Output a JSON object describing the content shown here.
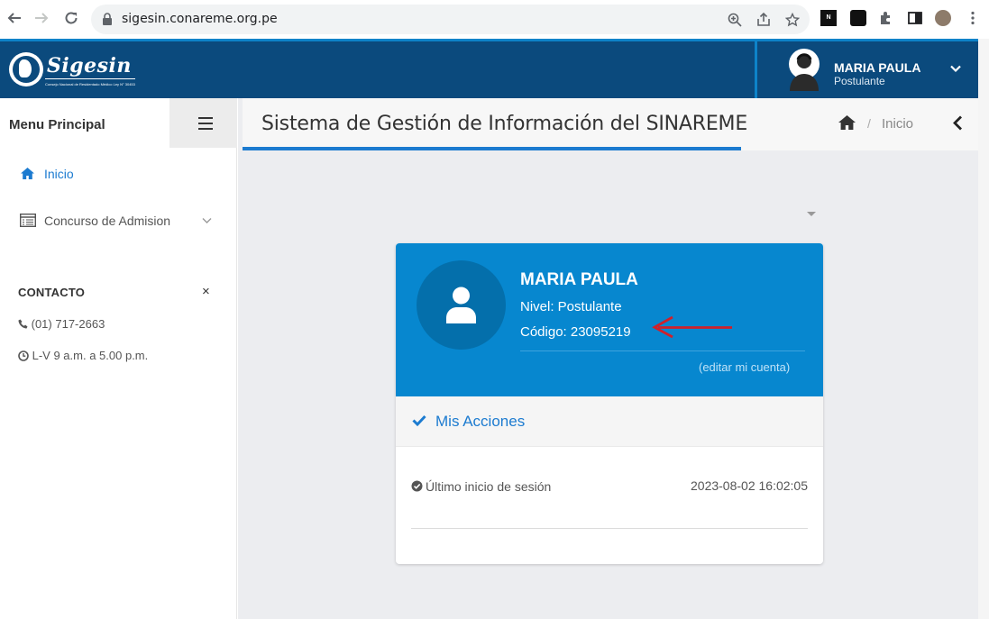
{
  "browser": {
    "url": "sigesin.conareme.org.pe"
  },
  "app": {
    "logo_text": "Sigesin",
    "logo_subtext": "Consejo Nacional de Residentado Médico Ley N° 30453",
    "user": {
      "name": "MARIA PAULA",
      "role": "Postulante"
    }
  },
  "sidebar": {
    "title": "Menu Principal",
    "items": [
      {
        "label": "Inicio",
        "active": true
      },
      {
        "label": "Concurso de Admision",
        "active": false
      }
    ],
    "contact": {
      "title": "CONTACTO",
      "phone": "(01) 717-2663",
      "hours": "L-V 9 a.m. a 5.00 p.m."
    }
  },
  "page": {
    "title": "Sistema de Gestión de Información del SINAREME",
    "breadcrumb_sep": "/",
    "breadcrumb": "Inicio"
  },
  "profile": {
    "name": "MARIA PAULA",
    "level": "Nivel: Postulante",
    "code": "Código: 23095219",
    "edit_link": "(editar mi cuenta)"
  },
  "actions": {
    "title": "Mis Acciones",
    "last_login_label": "Último inicio de sesión",
    "last_login_value": "2023-08-02 16:02:05"
  },
  "colors": {
    "header_bg": "#0b4a7d",
    "accent": "#1c7bd0",
    "card_blue": "#0787cf",
    "arrow": "#d0202a"
  }
}
